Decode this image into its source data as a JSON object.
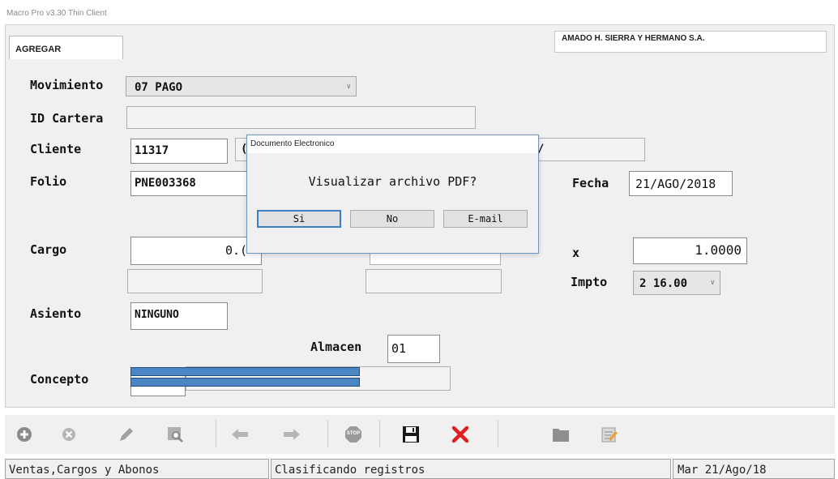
{
  "window": {
    "title": "Macro Pro v3.30 Thin Client"
  },
  "tab": {
    "label": "AGREGAR"
  },
  "company": {
    "name": "AMADO H. SIERRA Y HERMANO S.A."
  },
  "form": {
    "movimiento": {
      "label": "Movimiento",
      "value": "07 PAGO"
    },
    "id_cartera": {
      "label": "ID Cartera",
      "value": ""
    },
    "cliente": {
      "label": "Cliente",
      "value": "11317",
      "fragment_left": "(",
      "fragment_right": "/"
    },
    "folio": {
      "label": "Folio",
      "value": "PNE003368"
    },
    "fecha": {
      "label": "Fecha",
      "value": "21/AGO/2018"
    },
    "cargo": {
      "label": "Cargo",
      "value": "0.("
    },
    "tipo_cambio": {
      "label": "x",
      "value": "1.0000"
    },
    "impto": {
      "label": "Impto",
      "value": "2 16.00"
    },
    "asiento": {
      "label": "Asiento",
      "value": "NINGUNO"
    },
    "almacen": {
      "label": "Almacen",
      "value": "01"
    },
    "concepto": {
      "label": "Concepto",
      "value": ""
    }
  },
  "dialog": {
    "title": "Documento Electronico",
    "message": "Visualizar archivo PDF?",
    "buttons": {
      "si": "Si",
      "no": "No",
      "email": "E-mail"
    }
  },
  "statusbar": {
    "left": "Ventas,Cargos y Abonos",
    "middle": "Clasificando registros",
    "right": "Mar 21/Ago/18"
  },
  "toolbar": {
    "stop_text": "STOP",
    "icons": [
      "add-icon",
      "cancel-icon",
      "edit-icon",
      "search-icon",
      "back-arrow-icon",
      "forward-arrow-icon",
      "stop-icon",
      "save-icon",
      "delete-icon",
      "folder-icon",
      "notes-icon"
    ]
  },
  "colors": {
    "accent": "#3c7fc4",
    "delete": "#e02020",
    "toolbar_icon": "#8a8a8a"
  }
}
